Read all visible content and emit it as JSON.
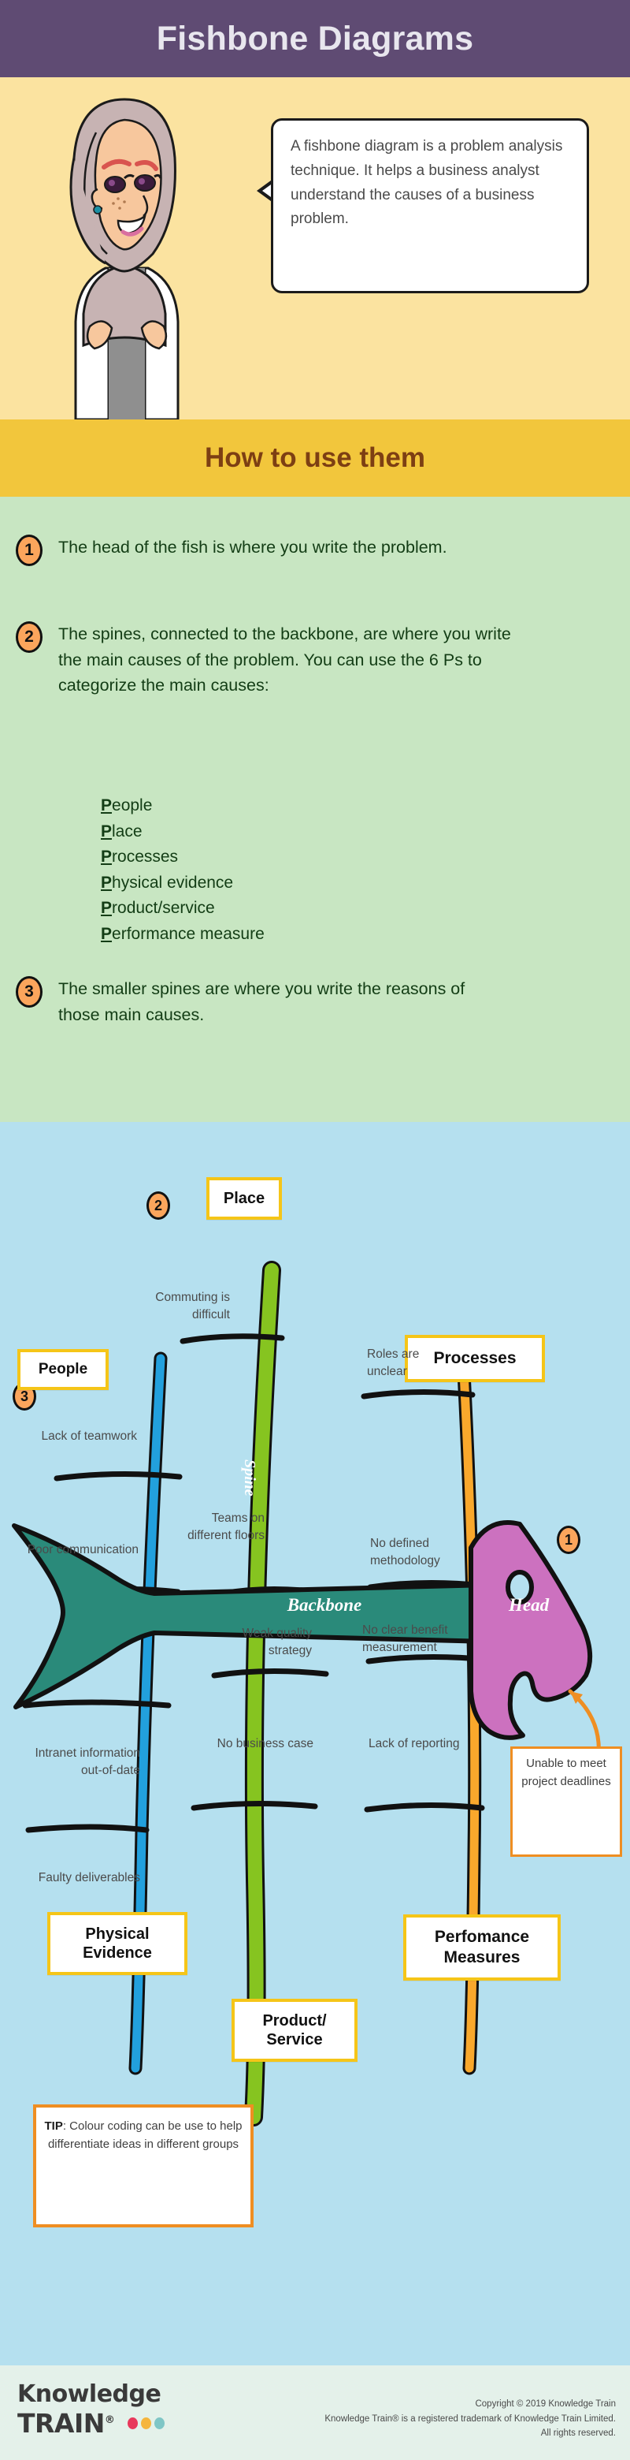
{
  "header": {
    "title": "Fishbone Diagrams",
    "bg": "#5f4b73",
    "text_color": "#e8e6ee"
  },
  "intro": {
    "bg": "#fbe3a0",
    "avatar_name": "female-business-analyst-avatar",
    "bubble_text": "A fishbone diagram is a problem analysis technique. It helps a business analyst understand the causes of a business problem."
  },
  "band": {
    "title": "How to use them",
    "bg": "#f2c63c",
    "text_color": "#7d3f13"
  },
  "steps": {
    "bg": "#c8e6c2",
    "items": [
      {
        "number": "1",
        "text": "The head of the fish is where you write the problem."
      },
      {
        "number": "2",
        "text": "The spines, connected to the backbone, are where you write the main causes of the problem. You can use the 6 Ps to categorize the main causes:"
      },
      {
        "number": "3",
        "text": "The smaller spines are where you write the reasons of those main causes."
      }
    ],
    "six_ps": [
      {
        "initial": "P",
        "rest": "eople"
      },
      {
        "initial": "P",
        "rest": "lace"
      },
      {
        "initial": "P",
        "rest": "rocesses"
      },
      {
        "initial": "P",
        "rest": "hysical evidence"
      },
      {
        "initial": "P",
        "rest": "roduct/service"
      },
      {
        "initial": "P",
        "rest": "erformance measure"
      }
    ]
  },
  "fishbone": {
    "bg": "#b5e0ef",
    "backbone_label": "Backbone",
    "head_label": "Head",
    "spine_label": "Spine",
    "badges": [
      {
        "number": "1",
        "target": "head"
      },
      {
        "number": "2",
        "target": "spine"
      },
      {
        "number": "3",
        "target": "small-spine"
      }
    ],
    "category_cards": [
      {
        "label": "People",
        "position": "top-left"
      },
      {
        "label": "Place",
        "position": "top-center"
      },
      {
        "label": "Processes",
        "position": "top-right"
      },
      {
        "label": "Physical Evidence",
        "position": "bottom-left"
      },
      {
        "label": "Product/ Service",
        "position": "bottom-center"
      },
      {
        "label": "Perfomance Measures",
        "position": "bottom-right"
      }
    ],
    "causes": [
      {
        "text": "Commuting is difficult",
        "group": "Place",
        "side": "top"
      },
      {
        "text": "Lack of teamwork",
        "group": "People",
        "side": "top"
      },
      {
        "text": "Poor communication",
        "group": "People",
        "side": "top"
      },
      {
        "text": "Teams on different floors",
        "group": "Place",
        "side": "top"
      },
      {
        "text": "Roles are unclear",
        "group": "Processes",
        "side": "top"
      },
      {
        "text": "No defined methodology",
        "group": "Processes",
        "side": "top"
      },
      {
        "text": "Intranet information out-of-date",
        "group": "Physical Evidence",
        "side": "bottom"
      },
      {
        "text": "Faulty deliverables",
        "group": "Physical Evidence",
        "side": "bottom"
      },
      {
        "text": "Weak quality strategy",
        "group": "Product/Service",
        "side": "bottom"
      },
      {
        "text": "No business case",
        "group": "Product/Service",
        "side": "bottom"
      },
      {
        "text": "No clear benefit measurement",
        "group": "Perfomance Measures",
        "side": "bottom"
      },
      {
        "text": "Lack of reporting",
        "group": "Perfomance Measures",
        "side": "bottom"
      }
    ],
    "problem_box": "Unable to meet project deadlines",
    "tip": {
      "label": "TIP",
      "text": ": Colour coding can be use to help differentiate ideas in different groups"
    },
    "colors": {
      "body": "#2a8a7a",
      "head": "#cc71bf",
      "spine_blue": "#22a0dd",
      "spine_green": "#86c420",
      "spine_orange": "#f9a82c",
      "card_border": "#f5c518",
      "tip_border": "#ef8e22",
      "badge": "#fba55c"
    }
  },
  "footer": {
    "bg": "#e4f1ea",
    "logo_line1": "Knowledge",
    "logo_line2": "TRAIN",
    "logo_reg": "®",
    "dot_colors": [
      "#e8395c",
      "#f5b53d",
      "#7fc6c6"
    ],
    "copyright_lines": [
      "Copyright © 2019 Knowledge Train",
      "Knowledge Train® is a registered trademark of Knowledge Train Limited.",
      "All rights reserved."
    ]
  }
}
